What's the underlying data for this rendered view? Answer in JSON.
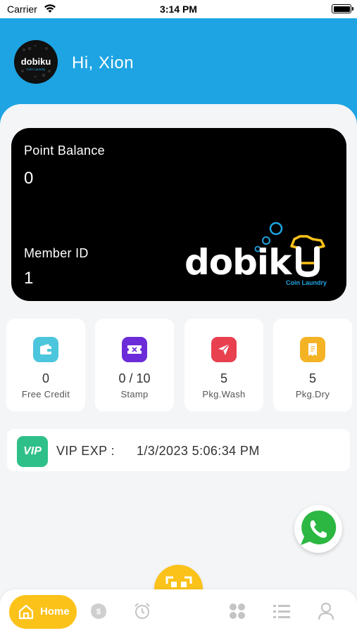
{
  "status_bar": {
    "carrier": "Carrier",
    "time": "3:14 PM"
  },
  "header": {
    "greeting": "Hi, Xion",
    "avatar_icon": "dobiku-logo-icon",
    "color": "#1ea4e2"
  },
  "card": {
    "point_balance_label": "Point Balance",
    "point_balance_value": "0",
    "member_id_label": "Member ID",
    "member_id_value": "1",
    "logo_text": "dobiku",
    "logo_subtext": "Coin Laundry"
  },
  "tiles": [
    {
      "value": "0",
      "label": "Free Credit",
      "icon": "wallet-icon",
      "color": "#4cc6dc"
    },
    {
      "value": "0 / 10",
      "label": "Stamp",
      "icon": "ticket-icon",
      "color": "#6c2bd9"
    },
    {
      "value": "5",
      "label": "Pkg.Wash",
      "icon": "send-icon",
      "color": "#e8404f"
    },
    {
      "value": "5",
      "label": "Pkg.Dry",
      "icon": "receipt-icon",
      "color": "#f4b325"
    }
  ],
  "vip": {
    "icon_text": "VIP",
    "label": "VIP EXP :",
    "date": "1/3/2023 5:06:34 PM"
  },
  "nav": {
    "home_label": "Home",
    "items": [
      "home-icon",
      "swap-coins-icon",
      "alarm-clock-icon",
      "qr-code-icon",
      "grid-icon",
      "list-icon",
      "profile-icon"
    ],
    "accent": "#fbc21a"
  }
}
